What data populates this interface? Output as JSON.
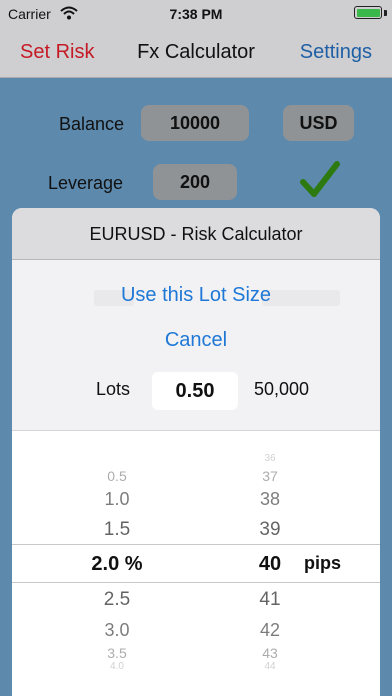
{
  "status_bar": {
    "carrier": "Carrier",
    "time": "7:38 PM"
  },
  "nav": {
    "left": "Set Risk",
    "title": "Fx Calculator",
    "right": "Settings"
  },
  "form": {
    "balance_label": "Balance",
    "balance_value": "10000",
    "currency": "USD",
    "leverage_label": "Leverage",
    "leverage_value": "200"
  },
  "sheet": {
    "title": "EURUSD - Risk Calculator",
    "use_lot_size": "Use this Lot Size",
    "cancel": "Cancel",
    "lots_label": "Lots",
    "lots_value": "0.50",
    "units": "50,000"
  },
  "picker": {
    "risk_col": [
      "0.5",
      "1.0",
      "1.5",
      "2.0 %",
      "2.5",
      "3.0",
      "3.5",
      "4.0"
    ],
    "pips_col": [
      "36",
      "37",
      "38",
      "39",
      "40",
      "41",
      "42",
      "43",
      "44"
    ],
    "pips_unit": "pips"
  },
  "colors": {
    "accent_red": "#c41a26",
    "accent_blue": "#1e5fa6",
    "check_green": "#2d7a10"
  }
}
